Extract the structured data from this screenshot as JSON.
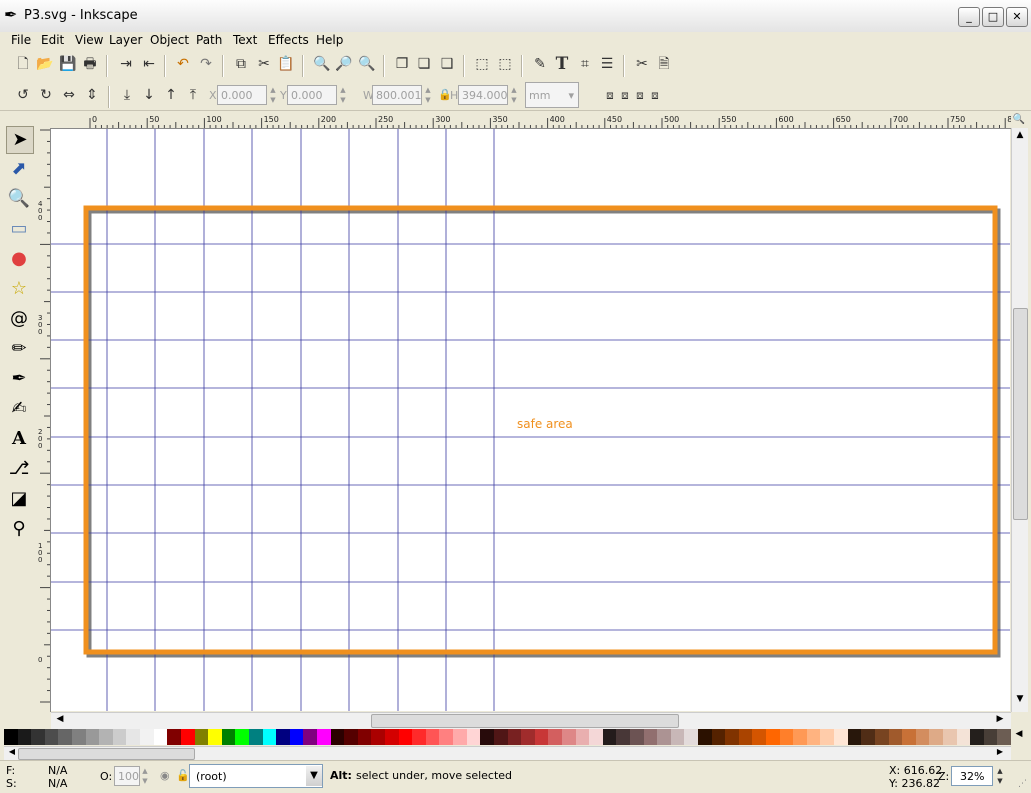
{
  "window": {
    "title": "P3.svg - Inkscape",
    "minimize": "_",
    "maximize": "□",
    "close": "✕"
  },
  "menu": [
    {
      "label": "File"
    },
    {
      "label": "Edit"
    },
    {
      "label": "View"
    },
    {
      "label": "Layer"
    },
    {
      "label": "Object"
    },
    {
      "label": "Path"
    },
    {
      "label": "Text"
    },
    {
      "label": "Effects"
    },
    {
      "label": "Help"
    }
  ],
  "commands_bar": {
    "icons": [
      "new-doc-icon",
      "open-icon",
      "save-icon",
      "print-icon",
      "import-icon",
      "export-icon",
      "undo-icon",
      "redo-icon",
      "copy-icon",
      "cut-icon",
      "paste-icon",
      "zoom-selection-icon",
      "zoom-drawing-icon",
      "zoom-page-icon",
      "duplicate-icon",
      "clone-icon",
      "unlink-clone-icon",
      "group-icon",
      "ungroup-icon",
      "fill-stroke-icon",
      "text-font-icon",
      "xml-editor-icon",
      "align-icon",
      "preferences-icon",
      "document-properties-icon"
    ]
  },
  "tool_controls": {
    "x_label": "X",
    "x_value": "0.000",
    "y_label": "Y",
    "y_value": "0.000",
    "w_label": "W",
    "w_value": "800.001",
    "h_label": "H",
    "h_value": "394.000",
    "unit": "mm"
  },
  "rulers": {
    "top_labels": [
      "0",
      "50",
      "100",
      "150",
      "200",
      "250",
      "300",
      "350",
      "400",
      "450",
      "500",
      "550",
      "600",
      "650",
      "700",
      "750",
      "800"
    ],
    "left_labels": [
      "400",
      "300",
      "200",
      "100",
      "0"
    ]
  },
  "canvas": {
    "annotation_text": "safe area",
    "frame_color": "#f0901e",
    "guide_color": "#3a3aa0",
    "vertical_guides": 9,
    "horizontal_guides": 9
  },
  "palette": [
    "#000000",
    "#1a1a1a",
    "#333333",
    "#4d4d4d",
    "#666666",
    "#808080",
    "#999999",
    "#b3b3b3",
    "#cccccc",
    "#e6e6e6",
    "#f2f2f2",
    "#ffffff",
    "#800000",
    "#ff0000",
    "#808000",
    "#ffff00",
    "#008000",
    "#00ff00",
    "#008080",
    "#00ffff",
    "#000080",
    "#0000ff",
    "#800080",
    "#ff00ff",
    "#2b0000",
    "#550000",
    "#800000",
    "#aa0000",
    "#d40000",
    "#ff0000",
    "#ff2a2a",
    "#ff5555",
    "#ff8080",
    "#ffaaaa",
    "#ffd5d5",
    "#280b0b",
    "#501616",
    "#782121",
    "#a02c2c",
    "#c83737",
    "#d35f5f",
    "#de8787",
    "#e9afaf",
    "#f4d7d7",
    "#241c1c",
    "#483737",
    "#6c5353",
    "#916f6f",
    "#ac9393",
    "#c8b7b7",
    "#e3dbdb",
    "#2b1100",
    "#552200",
    "#803300",
    "#aa4400",
    "#d45500",
    "#ff6600",
    "#ff7f2a",
    "#ff9955",
    "#ffb380",
    "#ffccaa",
    "#ffe6d5",
    "#28170b",
    "#502d16",
    "#784421",
    "#a05a2c",
    "#c87137",
    "#d38d5f",
    "#deaa87",
    "#e9c6af",
    "#f4e3d7",
    "#241f1c",
    "#483e37",
    "#6c5d53"
  ],
  "status": {
    "fill_label": "F:",
    "fill_value": "N/A",
    "stroke_label": "S:",
    "stroke_value": "N/A",
    "opacity_label": "O:",
    "opacity_value": "100",
    "layer": "(root)",
    "message_key": "Alt:",
    "message": "select under, move selected",
    "x_coord": "X: 616.62",
    "y_coord": "Y: 236.82",
    "zoom_label": "Z:",
    "zoom_value": "32%"
  }
}
